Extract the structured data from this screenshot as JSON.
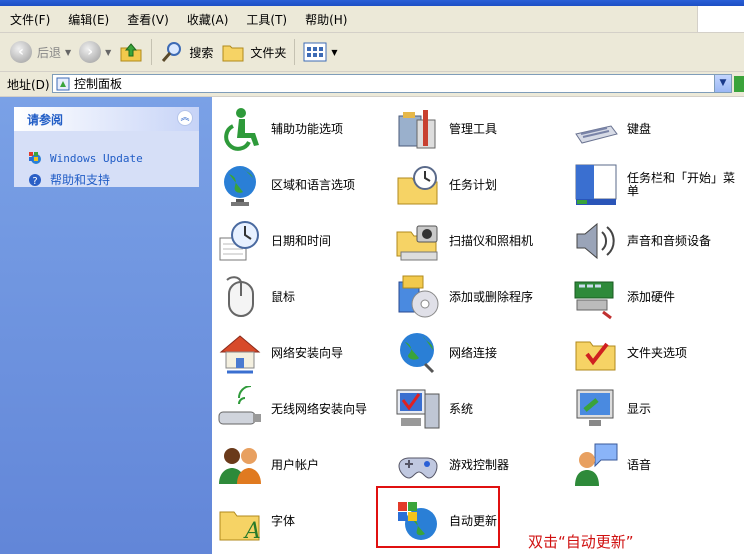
{
  "menu": [
    "文件(F)",
    "编辑(E)",
    "查看(V)",
    "收藏(A)",
    "工具(T)",
    "帮助(H)"
  ],
  "toolbar": {
    "back": "后退",
    "search": "搜索",
    "folders": "文件夹"
  },
  "address": {
    "label": "地址(D)",
    "value": "控制面板"
  },
  "taskpane": {
    "title": "请参阅",
    "links": [
      "Windows Update",
      "帮助和支持"
    ]
  },
  "items": [
    {
      "label": "辅助功能选项",
      "icon": "accessibility-icon"
    },
    {
      "label": "管理工具",
      "icon": "admin-tools-icon"
    },
    {
      "label": "键盘",
      "icon": "keyboard-icon"
    },
    {
      "label": "区域和语言选项",
      "icon": "globe-icon"
    },
    {
      "label": "任务计划",
      "icon": "scheduled-tasks-icon"
    },
    {
      "label": "任务栏和「开始」菜单",
      "icon": "taskbar-icon"
    },
    {
      "label": "日期和时间",
      "icon": "clock-icon"
    },
    {
      "label": "扫描仪和照相机",
      "icon": "scanner-icon"
    },
    {
      "label": "声音和音频设备",
      "icon": "speaker-icon"
    },
    {
      "label": "鼠标",
      "icon": "mouse-icon"
    },
    {
      "label": "添加或删除程序",
      "icon": "add-remove-programs-icon"
    },
    {
      "label": "添加硬件",
      "icon": "add-hardware-icon"
    },
    {
      "label": "网络安装向导",
      "icon": "home-network-icon"
    },
    {
      "label": "网络连接",
      "icon": "network-connections-icon"
    },
    {
      "label": "文件夹选项",
      "icon": "folder-options-icon"
    },
    {
      "label": "无线网络安装向导",
      "icon": "wireless-icon"
    },
    {
      "label": "系统",
      "icon": "system-icon"
    },
    {
      "label": "显示",
      "icon": "display-icon"
    },
    {
      "label": "用户帐户",
      "icon": "users-icon"
    },
    {
      "label": "游戏控制器",
      "icon": "gamepad-icon"
    },
    {
      "label": "语音",
      "icon": "speech-icon"
    },
    {
      "label": "字体",
      "icon": "fonts-icon"
    },
    {
      "label": "自动更新",
      "icon": "automatic-updates-icon"
    }
  ],
  "annotation": "双击“自动更新”"
}
